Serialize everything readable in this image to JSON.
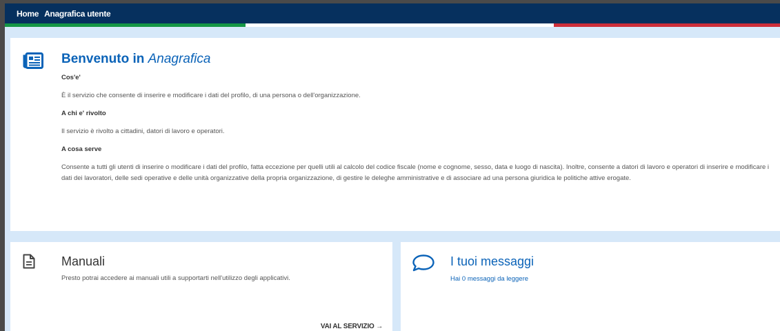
{
  "header": {
    "home_label": "Home",
    "page_label": "Anagrafica utente"
  },
  "main": {
    "title_prefix": "Benvenuto in",
    "title_emph": "Anagrafica",
    "sections": [
      {
        "heading": "Cos'e'",
        "text": "È il servizio che consente di inserire e modificare i dati del profilo, di una persona o dell'organizzazione."
      },
      {
        "heading": "A chi e' rivolto",
        "text": "Il servizio è rivolto a cittadini, datori di lavoro e operatori."
      },
      {
        "heading": "A cosa serve",
        "text": "Consente a tutti gli utenti di inserire o modificare i dati del profilo, fatta eccezione per quelli utili al calcolo del codice fiscale (nome e cognome, sesso, data e luogo di nascita). Inoltre, consente a datori di lavoro e operatori di inserire e modificare i dati dei lavoratori, delle sedi operative e delle unità organizzative della propria organizzazione, di gestire le deleghe amministrative e di associare ad una persona giuridica le politiche attive erogate."
      }
    ]
  },
  "manuali": {
    "title": "Manuali",
    "description": "Presto potrai accedere ai manuali utili a supportarti nell'utilizzo degli applicativi.",
    "link_label": "VAI AL SERVIZIO →"
  },
  "messaggi": {
    "title": "I tuoi messaggi",
    "description": "Hai 0 messaggi da leggere"
  },
  "icons": {
    "main": "newspaper-icon",
    "manuali": "document-icon",
    "messaggi": "chat-bubble-icon"
  },
  "colors": {
    "header_bg": "#06305e",
    "accent_blue": "#0b63b8",
    "page_bg": "#d6e8f9",
    "flag_green": "#149645",
    "flag_red": "#cd2e3a"
  }
}
